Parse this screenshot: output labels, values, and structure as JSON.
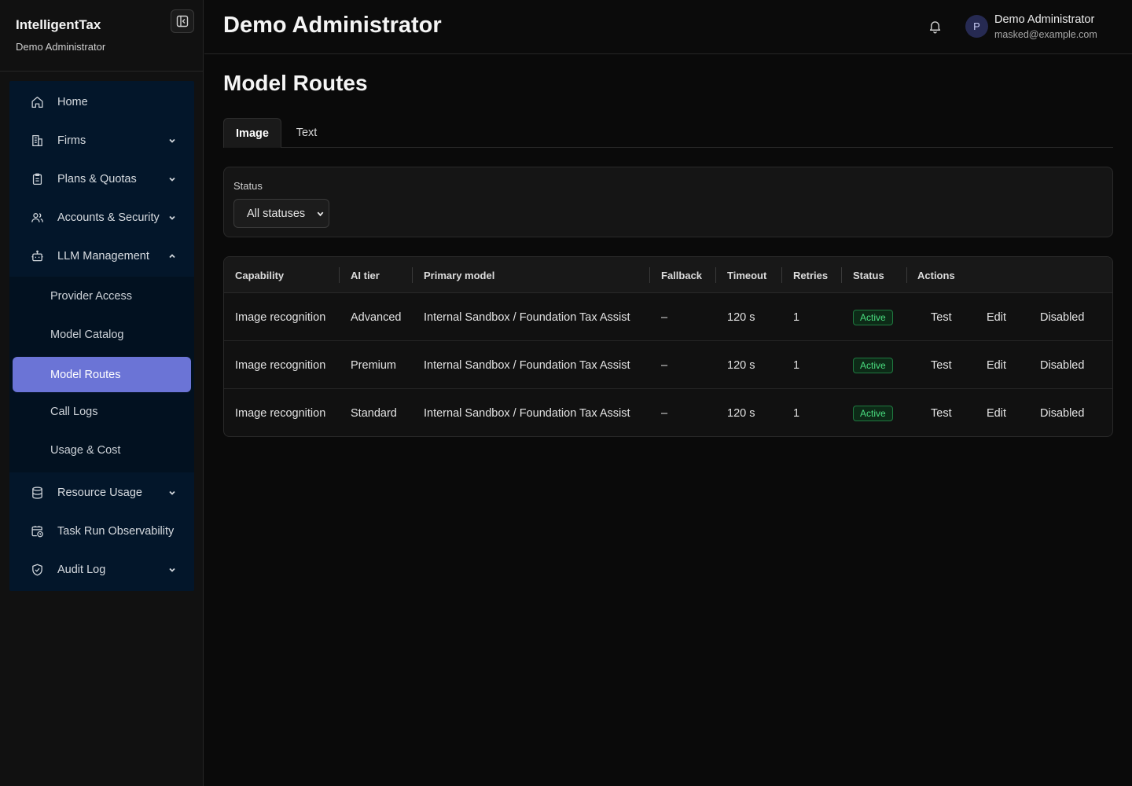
{
  "brand": {
    "name": "IntelligentTax",
    "subtitle": "Demo Administrator"
  },
  "sidebar": {
    "items": [
      {
        "label": "Home",
        "icon": "home-icon",
        "expandable": false
      },
      {
        "label": "Firms",
        "icon": "building-icon",
        "expandable": true
      },
      {
        "label": "Plans & Quotas",
        "icon": "clipboard-icon",
        "expandable": true
      },
      {
        "label": "Accounts & Security",
        "icon": "users-icon",
        "expandable": true
      },
      {
        "label": "LLM Management",
        "icon": "bot-icon",
        "expandable": true,
        "expanded": true
      }
    ],
    "llm_subitems": [
      {
        "label": "Provider Access"
      },
      {
        "label": "Model Catalog"
      },
      {
        "label": "Model Routes",
        "active": true
      },
      {
        "label": "Call Logs"
      },
      {
        "label": "Usage & Cost"
      }
    ],
    "bottom_items": [
      {
        "label": "Resource Usage",
        "icon": "database-icon",
        "expandable": true
      },
      {
        "label": "Task Run Observability",
        "icon": "calendar-clock-icon",
        "expandable": false
      },
      {
        "label": "Audit Log",
        "icon": "shield-check-icon",
        "expandable": true
      }
    ]
  },
  "header": {
    "title": "Demo Administrator",
    "user": {
      "avatar_letter": "P",
      "name": "Demo Administrator",
      "email": "masked@example.com"
    }
  },
  "main": {
    "title": "Model Routes",
    "tabs": [
      {
        "label": "Image",
        "active": true
      },
      {
        "label": "Text",
        "active": false
      }
    ],
    "filter": {
      "label": "Status",
      "selected": "All statuses"
    },
    "table": {
      "columns": [
        "Capability",
        "AI tier",
        "Primary model",
        "Fallback",
        "Timeout",
        "Retries",
        "Status",
        "Actions"
      ],
      "rows": [
        {
          "capability": "Image recognition",
          "tier": "Advanced",
          "primary": "Internal Sandbox / Foundation Tax Assist",
          "fallback": "–",
          "timeout": "120 s",
          "retries": "1",
          "status": "Active",
          "actions": [
            "Test",
            "Edit",
            "Disabled"
          ]
        },
        {
          "capability": "Image recognition",
          "tier": "Premium",
          "primary": "Internal Sandbox / Foundation Tax Assist",
          "fallback": "–",
          "timeout": "120 s",
          "retries": "1",
          "status": "Active",
          "actions": [
            "Test",
            "Edit",
            "Disabled"
          ]
        },
        {
          "capability": "Image recognition",
          "tier": "Standard",
          "primary": "Internal Sandbox / Foundation Tax Assist",
          "fallback": "–",
          "timeout": "120 s",
          "retries": "1",
          "status": "Active",
          "actions": [
            "Test",
            "Edit",
            "Disabled"
          ]
        }
      ]
    }
  },
  "colors": {
    "accent": "#6b74d6",
    "nav_bg": "#03162a",
    "status_active": "#4ade80",
    "background": "#0a0a0a"
  }
}
